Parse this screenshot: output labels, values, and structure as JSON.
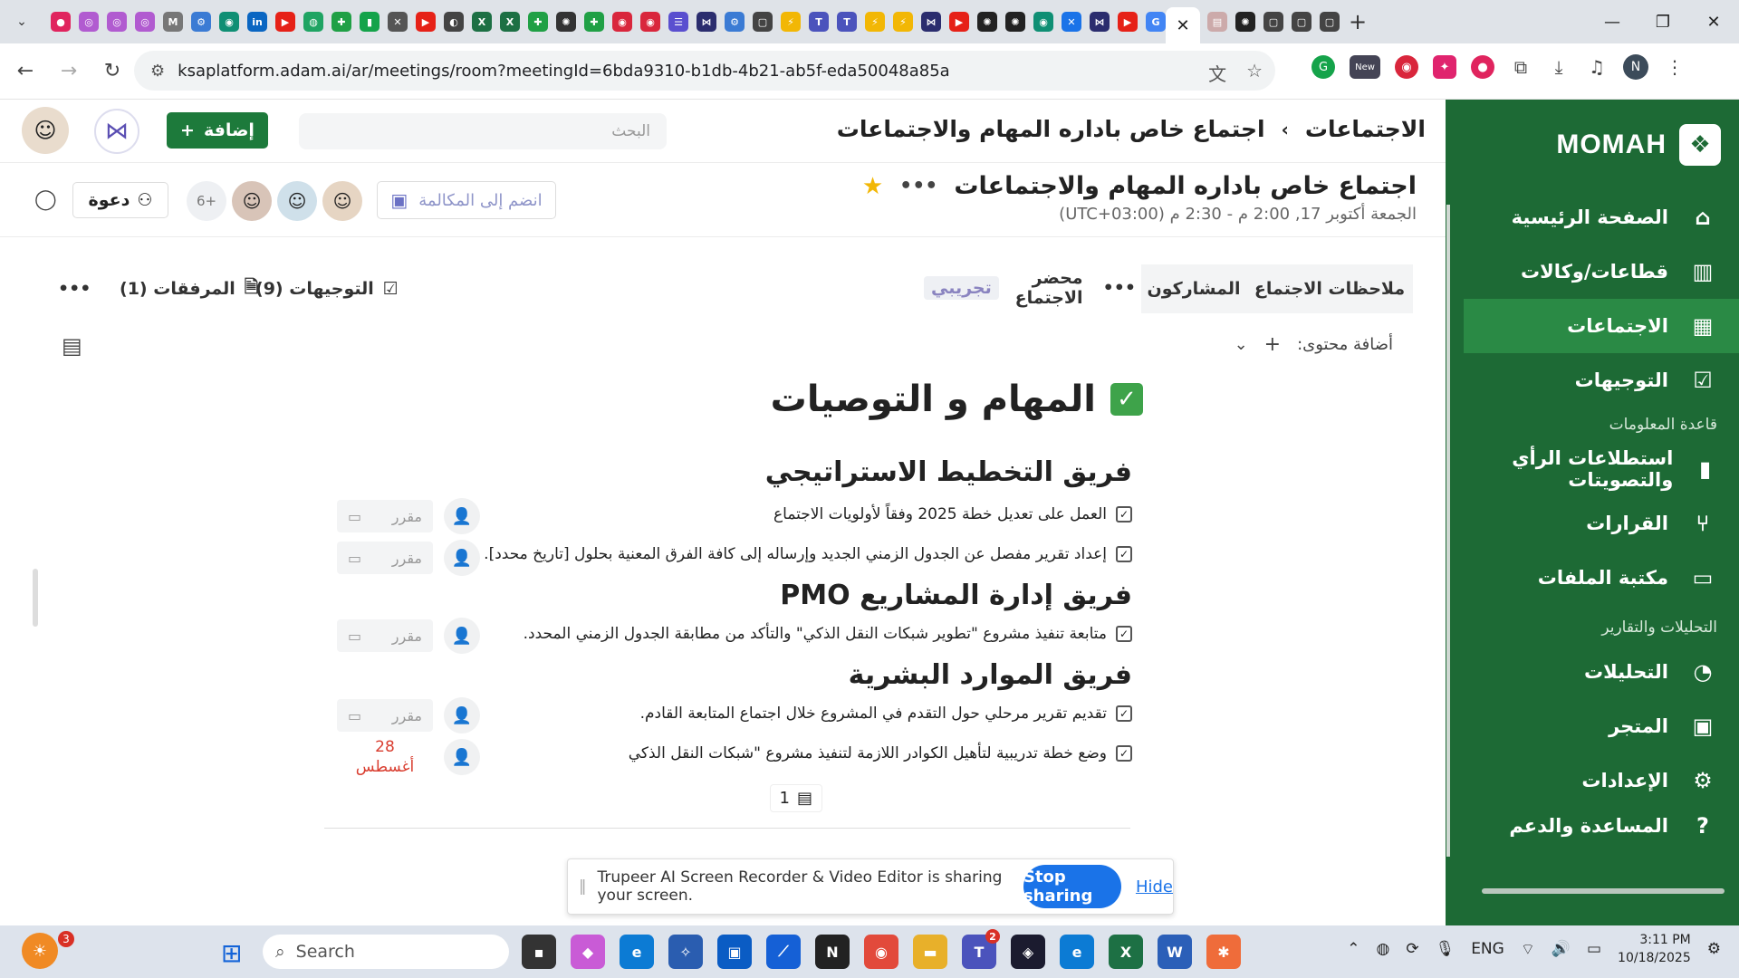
{
  "browser": {
    "url": "ksaplatform.adam.ai/ar/meetings/room?meetingId=6bda9310-b1db-4b21-ab5f-eda50048a85a",
    "new_badge": "New",
    "profile_initial": "N"
  },
  "sidebar": {
    "brand": "MOMAH",
    "items": [
      {
        "label": "الصفحة الرئيسية",
        "icon": "home-icon"
      },
      {
        "label": "قطاعات/وكالات",
        "icon": "building-icon"
      },
      {
        "label": "الاجتماعات",
        "icon": "calendar-icon"
      },
      {
        "label": "التوجيهات",
        "icon": "checkbox-icon"
      }
    ],
    "section_knowledge": "قاعدة المعلومات",
    "items2": [
      {
        "label": "استطلاعات الرأي والتصويتات",
        "icon": "poll-icon"
      },
      {
        "label": "القرارات",
        "icon": "decision-icon"
      },
      {
        "label": "مكتبة الملفات",
        "icon": "folder-icon"
      }
    ],
    "section_analytics": "التحليلات والتقارير",
    "items3": [
      {
        "label": "التحليلات",
        "icon": "analytics-icon"
      },
      {
        "label": "المتجر",
        "icon": "store-icon"
      },
      {
        "label": "الإعدادات",
        "icon": "gear-icon"
      },
      {
        "label": "المساعدة والدعم",
        "icon": "help-icon"
      }
    ]
  },
  "topbar": {
    "crumb_root": "الاجتماعات",
    "crumb_current": "اجتماع خاص باداره المهام والاجتماعات",
    "search_placeholder": "البحث",
    "add_label": "إضافة"
  },
  "meeting": {
    "title": "اجتماع خاص باداره المهام والاجتماعات",
    "time": "الجمعة أكتوبر 17, 2:00 م - 2:30 م (UTC+03:00)",
    "join_label": "انضم إلى المكالمة",
    "more_participants": "6+",
    "invite_label": "دعوة"
  },
  "tabs": {
    "notes": "ملاحظات الاجتماع",
    "participants": "المشاركون",
    "minutes": "محضر الاجتماع",
    "minutes_badge": "تجريبي",
    "directives": "التوجيهات (9)",
    "attachments": "المرفقات (1)"
  },
  "toolbar": {
    "add_content": "أضافة محتوى:"
  },
  "doc": {
    "heading": "المهام و التوصيات",
    "teams": [
      {
        "name": "فريق التخطيط الاستراتيجي"
      },
      {
        "name": "فريق إدارة المشاريع PMO"
      },
      {
        "name": "فريق الموارد البشرية"
      }
    ],
    "tasks": [
      {
        "text": "العمل على تعديل خطة 2025 وفقاً لأولويات الاجتماع",
        "due": "مقرر"
      },
      {
        "text": "إعداد تقرير مفصل عن الجدول الزمني الجديد وإرساله إلى كافة الفرق المعنية بحلول [تاريخ محدد].",
        "due": "مقرر"
      },
      {
        "text": "متابعة تنفيذ مشروع \"تطوير شبكات النقل الذكي\" والتأكد من مطابقة الجدول الزمني المحدد.",
        "due": "مقرر"
      },
      {
        "text": "تقديم تقرير مرحلي حول التقدم في المشروع خلال اجتماع المتابعة القادم.",
        "due": "مقرر"
      },
      {
        "text": "وضع خطة تدريبية لتأهيل الكوادر اللازمة لتنفيذ مشروع \"شبكات النقل الذكي",
        "due_day": "28",
        "due_month": "أغسطس"
      }
    ],
    "comments_count": "1"
  },
  "share_bar": {
    "message": "Trupeer AI Screen Recorder & Video Editor is sharing your screen.",
    "stop": "Stop sharing",
    "hide": "Hide"
  },
  "taskbar": {
    "weather_badge": "3",
    "search": "Search",
    "teams_badge": "2",
    "lang": "ENG",
    "time": "3:11 PM",
    "date": "10/18/2025"
  }
}
